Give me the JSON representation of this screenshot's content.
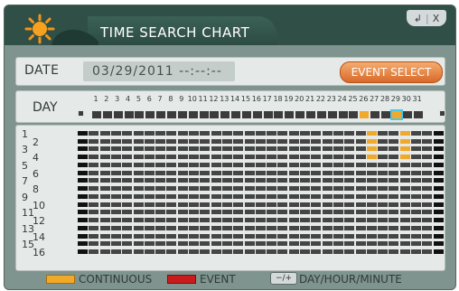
{
  "window": {
    "title": "TIME SEARCH CHART",
    "controls": {
      "back": "↲",
      "close": "X"
    }
  },
  "date": {
    "label": "DATE",
    "value": "03/29/2011  --:--:--"
  },
  "event_select": {
    "label": "EVENT SELECT"
  },
  "day": {
    "label": "DAY",
    "numbers": [
      "1",
      "2",
      "3",
      "4",
      "5",
      "6",
      "7",
      "8",
      "9",
      "10",
      "11",
      "12",
      "13",
      "14",
      "15",
      "16",
      "17",
      "18",
      "19",
      "20",
      "21",
      "22",
      "23",
      "24",
      "25",
      "26",
      "27",
      "28",
      "29",
      "30",
      "31"
    ],
    "recorded_days": [
      26,
      29
    ],
    "selected_day": 29
  },
  "channels": {
    "labels": [
      "1",
      "2",
      "3",
      "4",
      "5",
      "6",
      "7",
      "8",
      "9",
      "10",
      "11",
      "12",
      "13",
      "14",
      "15",
      "16"
    ],
    "recorded": {
      "days": [
        26,
        29
      ],
      "channels": [
        1,
        2,
        3,
        4
      ]
    }
  },
  "legend": {
    "continuous": "CONTINUOUS",
    "event": "EVENT",
    "keys": "−/+",
    "nav": "DAY/HOUR/MINUTE"
  },
  "colors": {
    "continuous": "#f0a92a",
    "event": "#c91b1b",
    "empty": "#454545",
    "selected_outline": "#49c7e9"
  }
}
